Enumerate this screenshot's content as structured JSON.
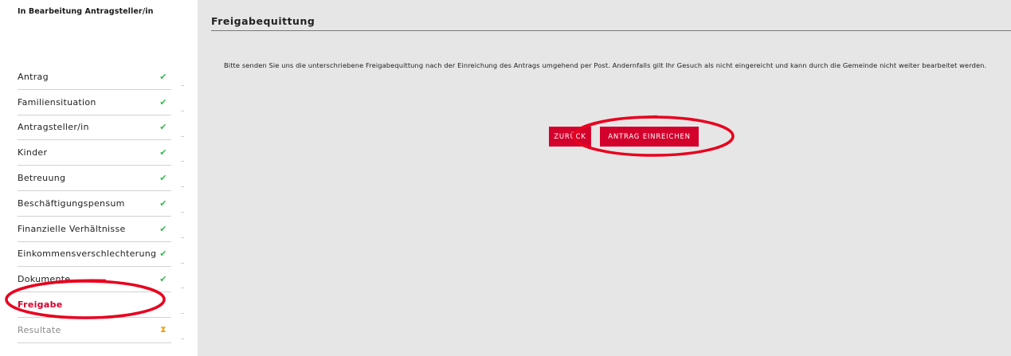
{
  "status": {
    "text": "In Bearbeitung Antragsteller/in"
  },
  "sidebar": {
    "items": [
      {
        "label": "Antrag",
        "icon": "check-icon",
        "state": "done"
      },
      {
        "label": "Familiensituation",
        "icon": "check-icon",
        "state": "done"
      },
      {
        "label": "Antragsteller/in",
        "icon": "check-icon",
        "state": "done"
      },
      {
        "label": "Kinder",
        "icon": "check-icon",
        "state": "done"
      },
      {
        "label": "Betreuung",
        "icon": "check-icon",
        "state": "done"
      },
      {
        "label": "Beschäftigungspensum",
        "icon": "check-icon",
        "state": "done"
      },
      {
        "label": "Finanzielle Verhältnisse",
        "icon": "check-icon",
        "state": "done"
      },
      {
        "label": "Einkommensverschlechterung",
        "icon": "check-icon",
        "state": "done"
      },
      {
        "label": "Dokumente",
        "icon": "check-icon",
        "state": "done"
      },
      {
        "label": "Freigabe",
        "icon": "",
        "state": "active"
      },
      {
        "label": "Resultate",
        "icon": "hourglass-icon",
        "state": "disabled"
      }
    ]
  },
  "main": {
    "title": "Freigabequittung",
    "instructions": "Bitte senden Sie uns die unterschriebene Freigabequittung nach der Einreichung des Antrags umgehend per Post. Andernfalls gilt Ihr Gesuch als nicht eingereicht und kann durch die Gemeinde nicht weiter bearbeitet werden.",
    "back_label": "ZURÜCK",
    "submit_label": "ANTRAG EINREICHEN"
  },
  "colors": {
    "accent": "#d4002c",
    "check": "#2fbf4a",
    "pending": "#e8a21a",
    "content_bg": "#e6e6e6",
    "annotation": "#e8001e"
  }
}
